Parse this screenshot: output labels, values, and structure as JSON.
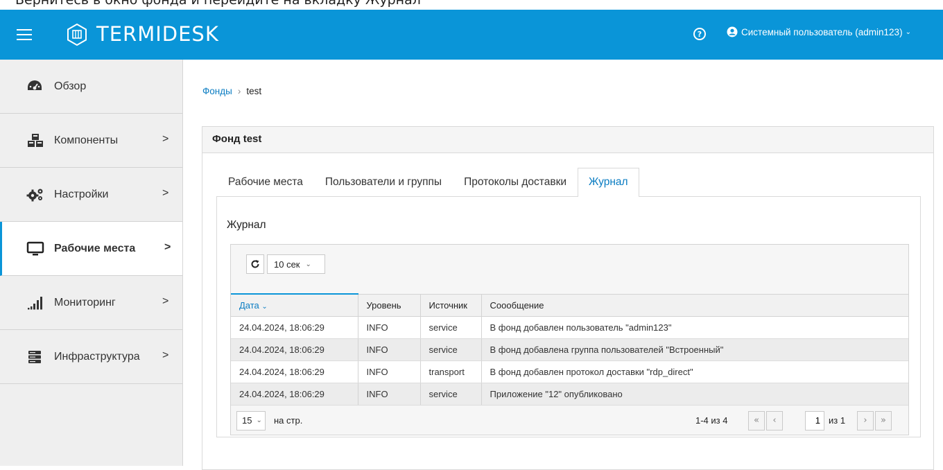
{
  "caption": "Вернитесь в окно фонда и перейдите на вкладку Журнал",
  "header": {
    "logo_text": "TERMIDESK",
    "user_label": "Системный пользователь (admin123)",
    "color": "#0a95d8"
  },
  "sidebar": {
    "items": [
      {
        "label": "Обзор",
        "icon": "dashboard-icon"
      },
      {
        "label": "Компоненты",
        "icon": "cubes-icon"
      },
      {
        "label": "Настройки",
        "icon": "gears-icon"
      },
      {
        "label": "Рабочие места",
        "icon": "monitor-icon"
      },
      {
        "label": "Мониторинг",
        "icon": "signal-bars-icon"
      },
      {
        "label": "Инфраструктура",
        "icon": "server-icon"
      }
    ],
    "chevron": ">"
  },
  "breadcrumb": {
    "root": "Фонды",
    "separator": "›",
    "current": "test"
  },
  "panel": {
    "title": "Фонд test"
  },
  "tabs": [
    "Рабочие места",
    "Пользователи и группы",
    "Протоколы доставки",
    "Журнал"
  ],
  "journal": {
    "title": "Журнал",
    "interval": "10 сек",
    "columns": [
      "Дата",
      "Уровень",
      "Источник",
      "Сооoбщение"
    ],
    "rows": [
      [
        "24.04.2024, 18:06:29",
        "INFO",
        "service",
        "В фонд добавлен пользователь \"admin123\""
      ],
      [
        "24.04.2024, 18:06:29",
        "INFO",
        "service",
        "В фонд добавлена группа пользователей \"Встроенный\""
      ],
      [
        "24.04.2024, 18:06:29",
        "INFO",
        "transport",
        "В фонд добавлен протокол доставки \"rdp_direct\""
      ],
      [
        "24.04.2024, 18:06:29",
        "INFO",
        "service",
        "Приложение \"12\" опубликовано"
      ]
    ],
    "pager": {
      "per_page": "15",
      "per_page_label": "на стр.",
      "range": "1-4 из 4",
      "page": "1",
      "of": "из 1"
    }
  }
}
